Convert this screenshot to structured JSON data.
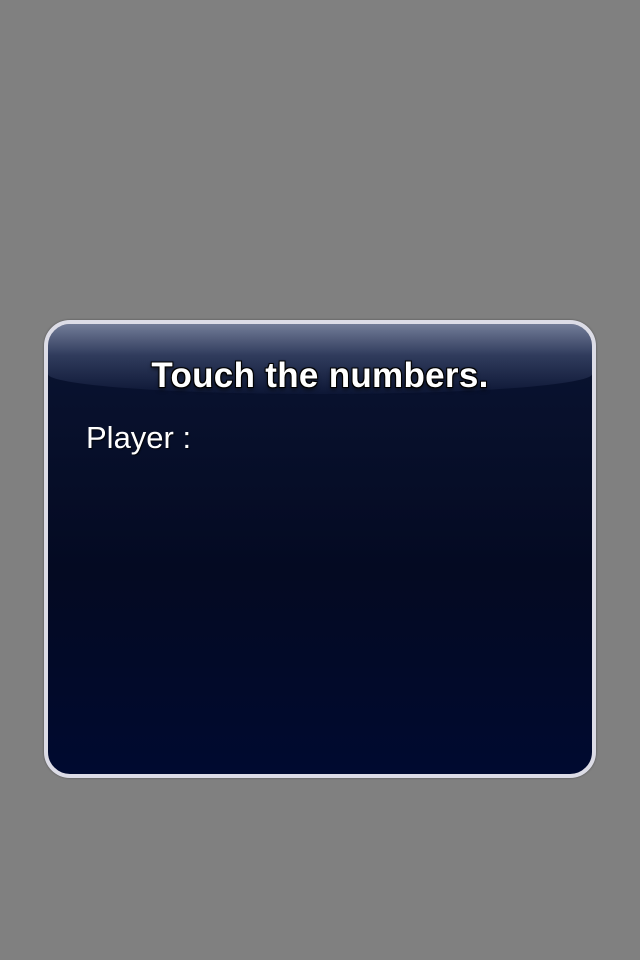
{
  "dialog": {
    "title": "Touch the numbers.",
    "player_label": "Player :",
    "player_name": ""
  },
  "colors": {
    "background": "#808080",
    "dialog_bg": "#040a22",
    "dialog_border": "#dcdce6",
    "text": "#ffffff"
  }
}
